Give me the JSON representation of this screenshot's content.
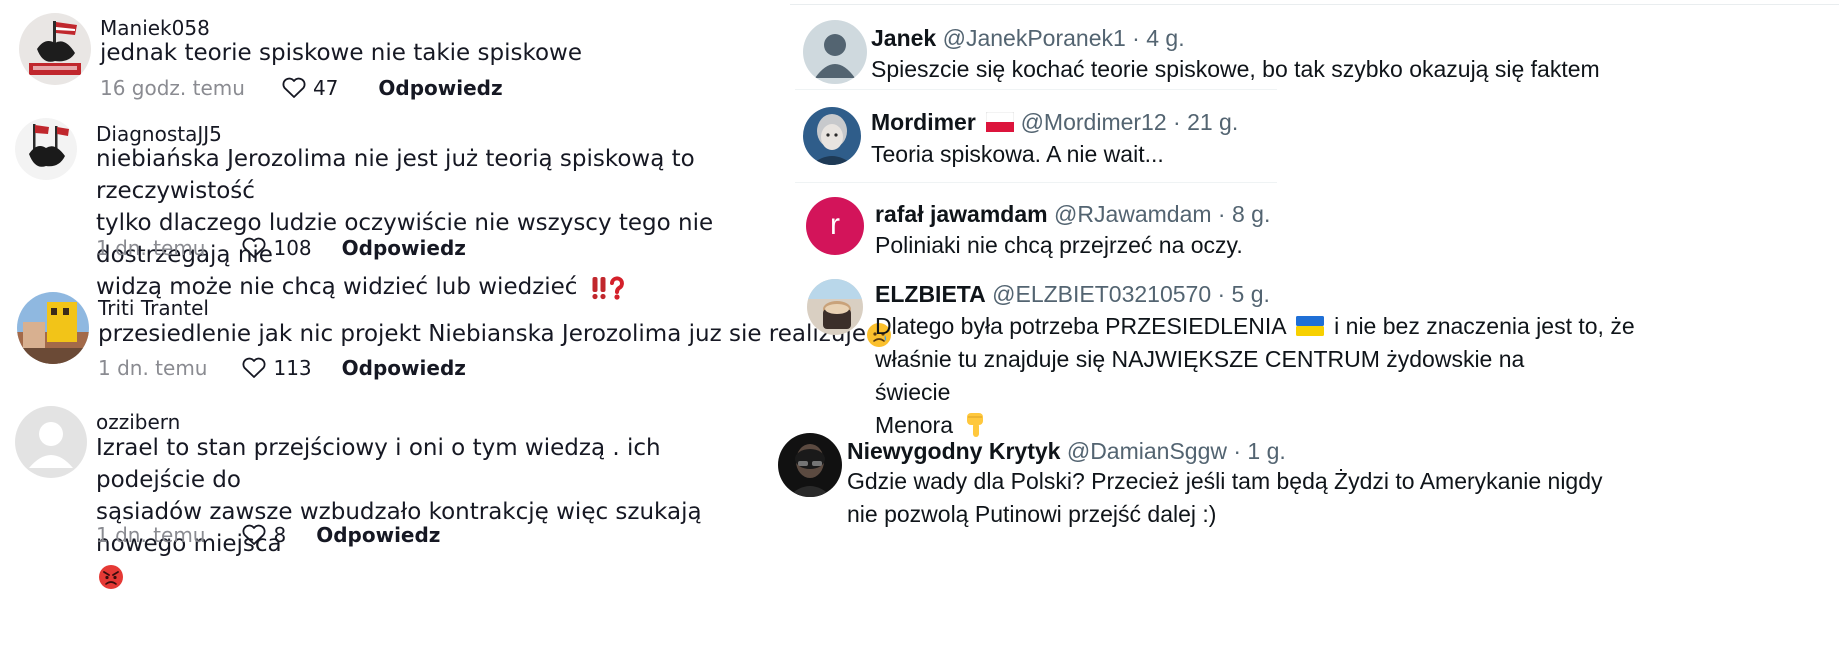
{
  "left_comments": [
    {
      "username": "Maniek058",
      "text": "jednak teorie spiskowe nie takie spiskowe",
      "time": "16 godz. temu",
      "likes": "47",
      "reply_label": "Odpowiedz"
    },
    {
      "username": "DiagnostaJJ5",
      "text_lines": [
        "niebiańska Jerozolima nie jest już teorią spiskową to rzeczywistość",
        "tylko dlaczego ludzie oczywiście nie wszyscy tego nie dostrzegają nie",
        "widzą może nie chcą widzieć lub wiedzieć"
      ],
      "emoji": [
        "double-exclamation-emoji",
        "question-mark-emoji"
      ],
      "time": "1 dn. temu",
      "likes": "108",
      "reply_label": "Odpowiedz"
    },
    {
      "username": "Triti Trantel",
      "text": "przesiedlenie jak nic projekt Niebianska Jerozolima juz sie realizuje",
      "emoji": [
        "sad-face-emoji"
      ],
      "time": "1 dn. temu",
      "likes": "113",
      "reply_label": "Odpowiedz"
    },
    {
      "username": "ozzibern",
      "text_lines": [
        "Izrael to stan przejściowy i oni o tym wiedzą . ich podejście do",
        "sąsiadów zawsze wzbudzało kontrakcję więc szukają nowego miejsca"
      ],
      "emoji": [
        "angry-face-emoji"
      ],
      "time": "1 dn. temu",
      "likes": "8",
      "reply_label": "Odpowiedz"
    }
  ],
  "right_posts": [
    {
      "name": "Janek",
      "meta": "@JanekPoranek1 · 4 g.",
      "text": "Spieszcie się kochać teorie spiskowe, bo tak szybko okazują się faktem"
    },
    {
      "name": "Mordimer",
      "flag": "poland-flag-icon",
      "meta": "@Mordimer12 · 21 g.",
      "text": "Teoria spiskowa. A nie wait..."
    },
    {
      "name": "rafał jawamdam",
      "avatar_letter": "r",
      "avatar_color": "#d3145a",
      "meta": "@RJawamdam · 8 g.",
      "text": "Poliniaki nie chcą przejrzeć na oczy."
    },
    {
      "name": "ELZBIETA",
      "meta": "@ELZBIET03210570 · 5 g.",
      "text_lines": [
        "Dlatego była potrzeba PRZESIEDLENIA",
        "i nie bez znaczenia jest to, że",
        "właśnie tu znajduje się NAJWIĘKSZE CENTRUM żydowskie na świecie",
        "Menora"
      ],
      "emoji": [
        "ukraine-flag-icon",
        "pointing-down-emoji"
      ]
    },
    {
      "name": "Niewygodny Krytyk",
      "meta": "@DamianSggw · 1 g.",
      "text_lines": [
        "Gdzie wady dla Polski? Przecież jeśli tam będą Żydzi to Amerykanie nigdy",
        "nie pozwolą Putinowi przejść dalej :)"
      ]
    }
  ]
}
